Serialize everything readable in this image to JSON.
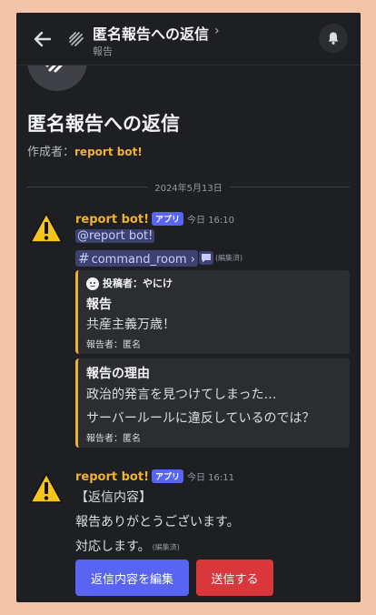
{
  "header": {
    "title": "匿名報告への返信",
    "chevron": "›",
    "subtitle": "報告"
  },
  "thread": {
    "title": "匿名報告への返信",
    "creator_label": "作成者：",
    "creator_name": "report bot!"
  },
  "date_divider": "2024年5月13日",
  "messages": [
    {
      "author": "report bot!",
      "tag": "アプリ",
      "timestamp": "今日 16:10",
      "mention": "@report bot!",
      "channel": "command_room",
      "channel_chevron": "›",
      "edited": "(編集済)",
      "embeds": [
        {
          "author": "投稿者：やにけ",
          "title": "報告",
          "description": "共産主義万歳！",
          "footer": "報告者：匿名"
        },
        {
          "title": "報告の理由",
          "description_lines": [
            "政治的発言を見つけてしまった…",
            "サーバールールに違反しているのでは？"
          ],
          "footer": "報告者：匿名"
        }
      ]
    },
    {
      "author": "report bot!",
      "tag": "アプリ",
      "timestamp": "今日 16:11",
      "lines": [
        "【返信内容】",
        "報告ありがとうございます。",
        "対応します。"
      ],
      "edited": "(編集済)",
      "buttons": {
        "edit": "返信内容を編集",
        "send": "送信する"
      }
    }
  ],
  "colors": {
    "accent": "#5865f2",
    "author": "#f0b232",
    "danger": "#da373c",
    "background": "#1e1f22",
    "embed_bg": "#2b2d31"
  }
}
